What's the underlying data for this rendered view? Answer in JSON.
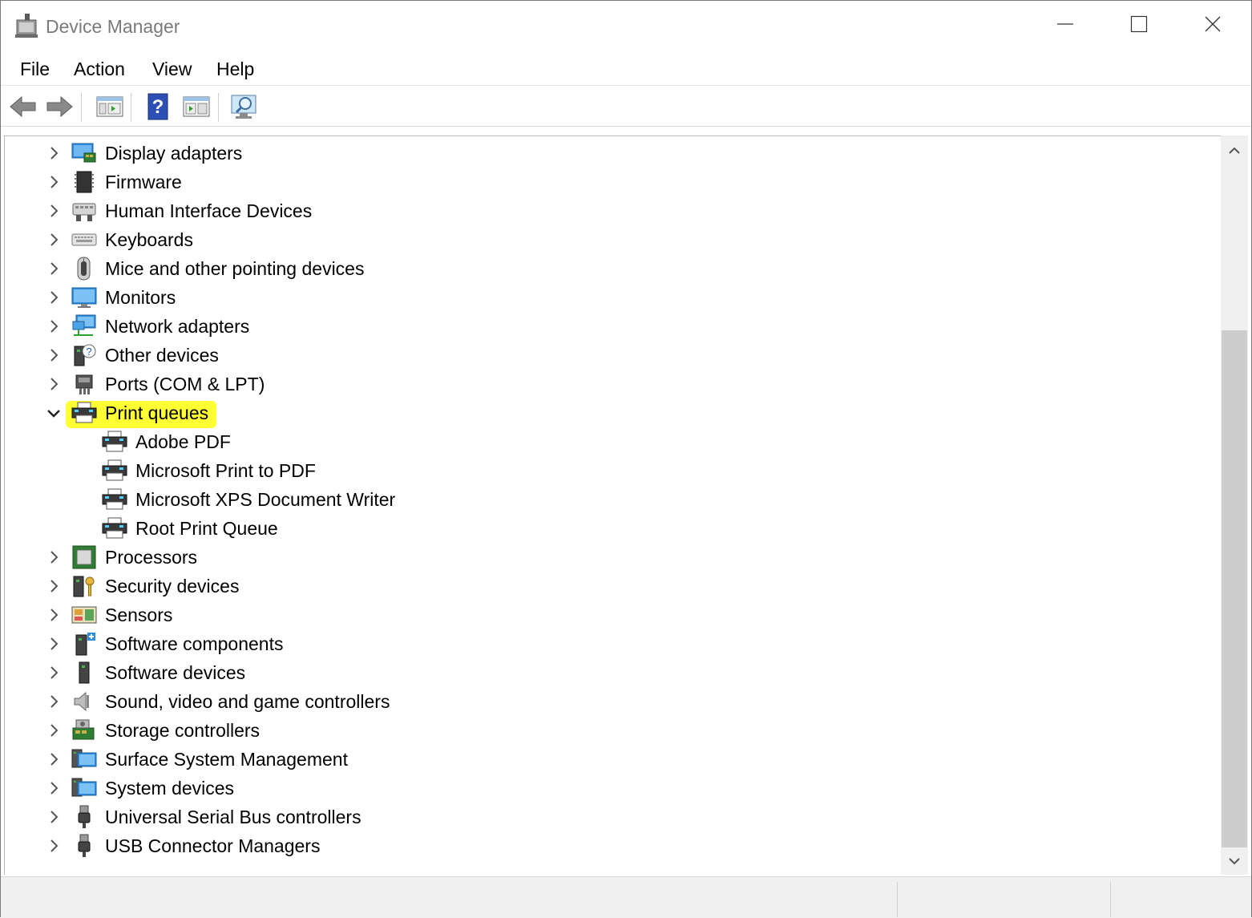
{
  "window": {
    "title": "Device Manager",
    "controls": {
      "minimize": "minimize",
      "maximize": "maximize",
      "close": "close"
    }
  },
  "menu": {
    "items": [
      "File",
      "Action",
      "View",
      "Help"
    ]
  },
  "toolbar": {
    "buttons": [
      "back-icon",
      "forward-icon",
      "properties-view-icon",
      "help-icon",
      "show-hide-console-tree-icon",
      "scan-hardware-icon"
    ]
  },
  "tree": {
    "items": [
      {
        "label": "Display adapters",
        "icon": "display-adapter-icon",
        "expanded": false,
        "level": 1
      },
      {
        "label": "Firmware",
        "icon": "firmware-icon",
        "expanded": false,
        "level": 1
      },
      {
        "label": "Human Interface Devices",
        "icon": "hid-icon",
        "expanded": false,
        "level": 1
      },
      {
        "label": "Keyboards",
        "icon": "keyboard-icon",
        "expanded": false,
        "level": 1
      },
      {
        "label": "Mice and other pointing devices",
        "icon": "mouse-icon",
        "expanded": false,
        "level": 1
      },
      {
        "label": "Monitors",
        "icon": "monitor-icon",
        "expanded": false,
        "level": 1
      },
      {
        "label": "Network adapters",
        "icon": "network-adapter-icon",
        "expanded": false,
        "level": 1
      },
      {
        "label": "Other devices",
        "icon": "other-devices-icon",
        "expanded": false,
        "level": 1
      },
      {
        "label": "Ports (COM & LPT)",
        "icon": "port-icon",
        "expanded": false,
        "level": 1
      },
      {
        "label": "Print queues",
        "icon": "printer-icon",
        "expanded": true,
        "level": 1,
        "highlighted": true
      },
      {
        "label": "Adobe PDF",
        "icon": "printer-icon",
        "level": 2
      },
      {
        "label": "Microsoft Print to PDF",
        "icon": "printer-icon",
        "level": 2
      },
      {
        "label": "Microsoft XPS Document Writer",
        "icon": "printer-icon",
        "level": 2
      },
      {
        "label": "Root Print Queue",
        "icon": "printer-icon",
        "level": 2
      },
      {
        "label": "Processors",
        "icon": "processor-icon",
        "expanded": false,
        "level": 1
      },
      {
        "label": "Security devices",
        "icon": "security-device-icon",
        "expanded": false,
        "level": 1
      },
      {
        "label": "Sensors",
        "icon": "sensor-icon",
        "expanded": false,
        "level": 1
      },
      {
        "label": "Software components",
        "icon": "software-component-icon",
        "expanded": false,
        "level": 1
      },
      {
        "label": "Software devices",
        "icon": "software-device-icon",
        "expanded": false,
        "level": 1
      },
      {
        "label": "Sound, video and game controllers",
        "icon": "speaker-icon",
        "expanded": false,
        "level": 1
      },
      {
        "label": "Storage controllers",
        "icon": "storage-controller-icon",
        "expanded": false,
        "level": 1
      },
      {
        "label": "Surface System Management",
        "icon": "system-device-icon",
        "expanded": false,
        "level": 1
      },
      {
        "label": "System devices",
        "icon": "system-device-icon",
        "expanded": false,
        "level": 1
      },
      {
        "label": "Universal Serial Bus controllers",
        "icon": "usb-icon",
        "expanded": false,
        "level": 1
      },
      {
        "label": "USB Connector Managers",
        "icon": "usb-icon",
        "expanded": false,
        "level": 1
      }
    ]
  },
  "colors": {
    "highlight": "#ffff33",
    "title_text": "#7a7a7a",
    "monitor_blue": "#2e8de0",
    "scrollbar_track": "#f0f0f0",
    "scrollbar_thumb": "#cdcdcd"
  }
}
